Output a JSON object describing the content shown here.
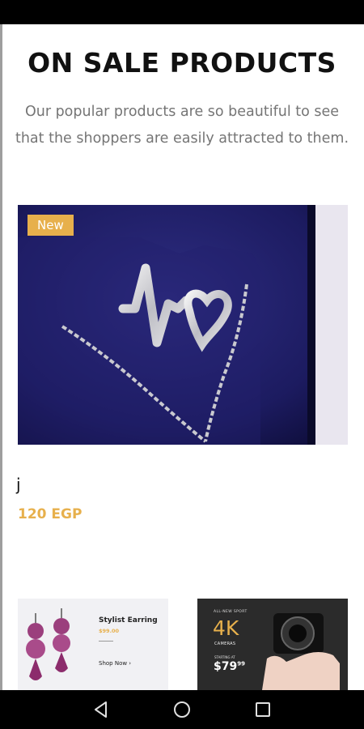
{
  "section": {
    "title": "ON SALE PRODUCTS",
    "subtitle": "Our popular products are so beautiful to see that the shoppers are easily attracted to them."
  },
  "product": {
    "badge": "New",
    "name": "j",
    "price": "120 EGP"
  },
  "banners": {
    "earring": {
      "title": "Stylist Earring",
      "price": "$99.00",
      "cta": "Shop Now ›"
    },
    "camera": {
      "tagline": "ALL-NEW SPORT",
      "headline": "4K",
      "subhead": "CAMERAS",
      "starting": "STARTING AT",
      "price_main": "$79",
      "price_cents": "99"
    }
  },
  "navigation": {
    "back_icon": "back-triangle-icon",
    "home_icon": "home-circle-icon",
    "recent_icon": "recent-apps-square-icon"
  },
  "colors": {
    "accent": "#e7b04c",
    "title": "#111111",
    "subtitle": "#757575"
  }
}
